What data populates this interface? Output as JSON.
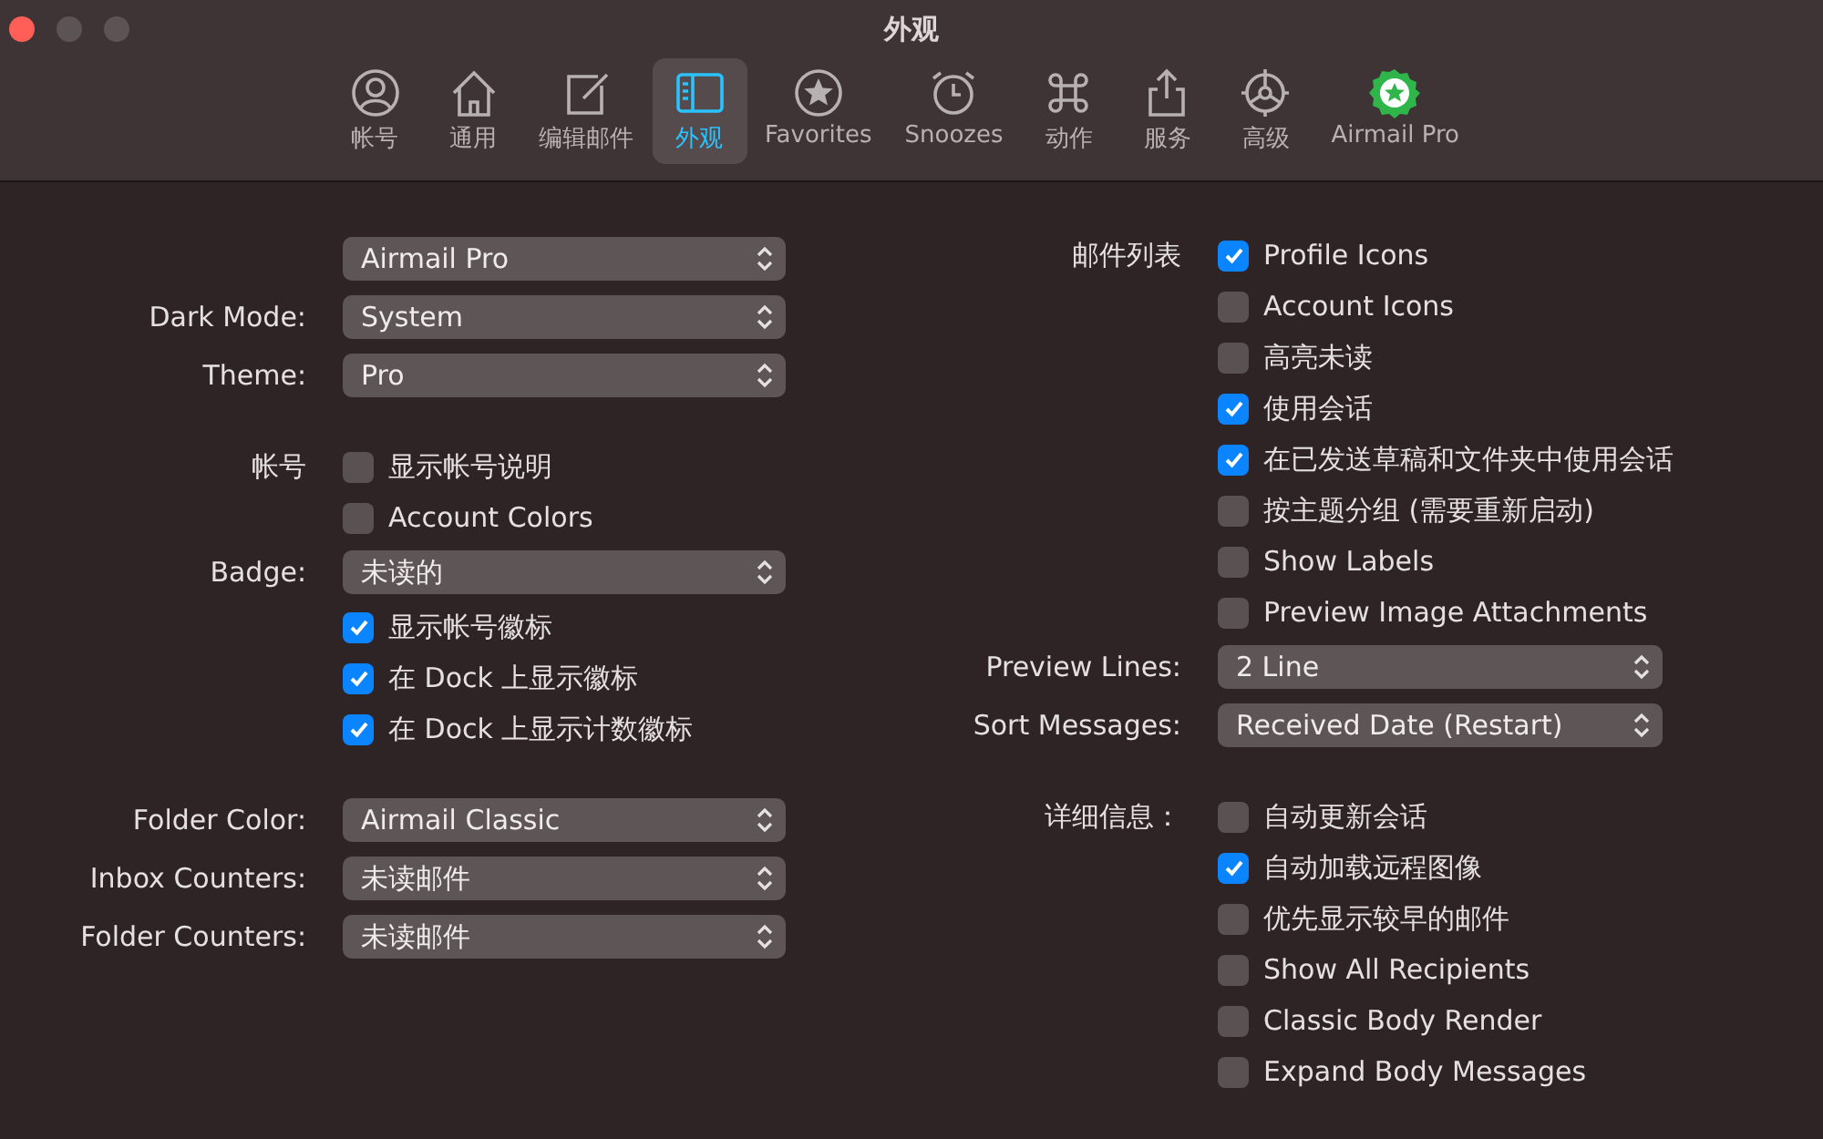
{
  "window": {
    "title": "外观"
  },
  "tabs": [
    {
      "label": "帐号",
      "selected": false
    },
    {
      "label": "通用",
      "selected": false
    },
    {
      "label": "编辑邮件",
      "selected": false
    },
    {
      "label": "外观",
      "selected": true
    },
    {
      "label": "Favorites",
      "selected": false
    },
    {
      "label": "Snoozes",
      "selected": false
    },
    {
      "label": "动作",
      "selected": false
    },
    {
      "label": "服务",
      "selected": false
    },
    {
      "label": "高级",
      "selected": false
    },
    {
      "label": "Airmail Pro",
      "selected": false
    }
  ],
  "left_groups": [
    [
      {
        "kind": "select",
        "value": "Airmail Pro"
      },
      {
        "kind": "select",
        "label": "Dark Mode:",
        "value": "System"
      },
      {
        "kind": "select",
        "label": "Theme:",
        "value": "Pro"
      }
    ],
    [
      {
        "kind": "checkbox",
        "label": "帐号",
        "value": "显示帐号说明",
        "checked": false
      },
      {
        "kind": "checkbox",
        "value": "Account Colors",
        "checked": false
      },
      {
        "kind": "select",
        "label": "Badge:",
        "value": "未读的"
      },
      {
        "kind": "checkbox",
        "value": "显示帐号徽标",
        "checked": true
      },
      {
        "kind": "checkbox",
        "value": "在 Dock 上显示徽标",
        "checked": true
      },
      {
        "kind": "checkbox",
        "value": "在 Dock 上显示计数徽标",
        "checked": true
      }
    ],
    [
      {
        "kind": "select",
        "label": "Folder Color:",
        "value": "Airmail Classic"
      },
      {
        "kind": "select",
        "label": "Inbox Counters:",
        "value": "未读邮件"
      },
      {
        "kind": "select",
        "label": "Folder Counters:",
        "value": "未读邮件"
      }
    ]
  ],
  "right_groups": [
    [
      {
        "kind": "checkbox",
        "label": "邮件列表",
        "value": "Profile Icons",
        "checked": true
      },
      {
        "kind": "checkbox",
        "value": "Account Icons",
        "checked": false
      },
      {
        "kind": "checkbox",
        "value": "高亮未读",
        "checked": false
      },
      {
        "kind": "checkbox",
        "value": "使用会话",
        "checked": true
      },
      {
        "kind": "checkbox",
        "value": "在已发送草稿和文件夹中使用会话",
        "checked": true
      },
      {
        "kind": "checkbox",
        "value": "按主题分组 (需要重新启动)",
        "checked": false
      },
      {
        "kind": "checkbox",
        "value": "Show Labels",
        "checked": false
      },
      {
        "kind": "checkbox",
        "value": "Preview Image Attachments",
        "checked": false
      },
      {
        "kind": "select",
        "label": "Preview Lines:",
        "value": "2 Line"
      },
      {
        "kind": "select",
        "label": "Sort Messages:",
        "value": "Received Date (Restart)"
      }
    ],
    [
      {
        "kind": "checkbox",
        "label": "详细信息：",
        "value": "自动更新会话",
        "checked": false
      },
      {
        "kind": "checkbox",
        "value": "自动加载远程图像",
        "checked": true
      },
      {
        "kind": "checkbox",
        "value": "优先显示较早的邮件",
        "checked": false
      },
      {
        "kind": "checkbox",
        "value": "Show All Recipients",
        "checked": false
      },
      {
        "kind": "checkbox",
        "value": "Classic Body Render",
        "checked": false
      },
      {
        "kind": "checkbox",
        "value": "Expand Body Messages",
        "checked": false
      }
    ]
  ]
}
